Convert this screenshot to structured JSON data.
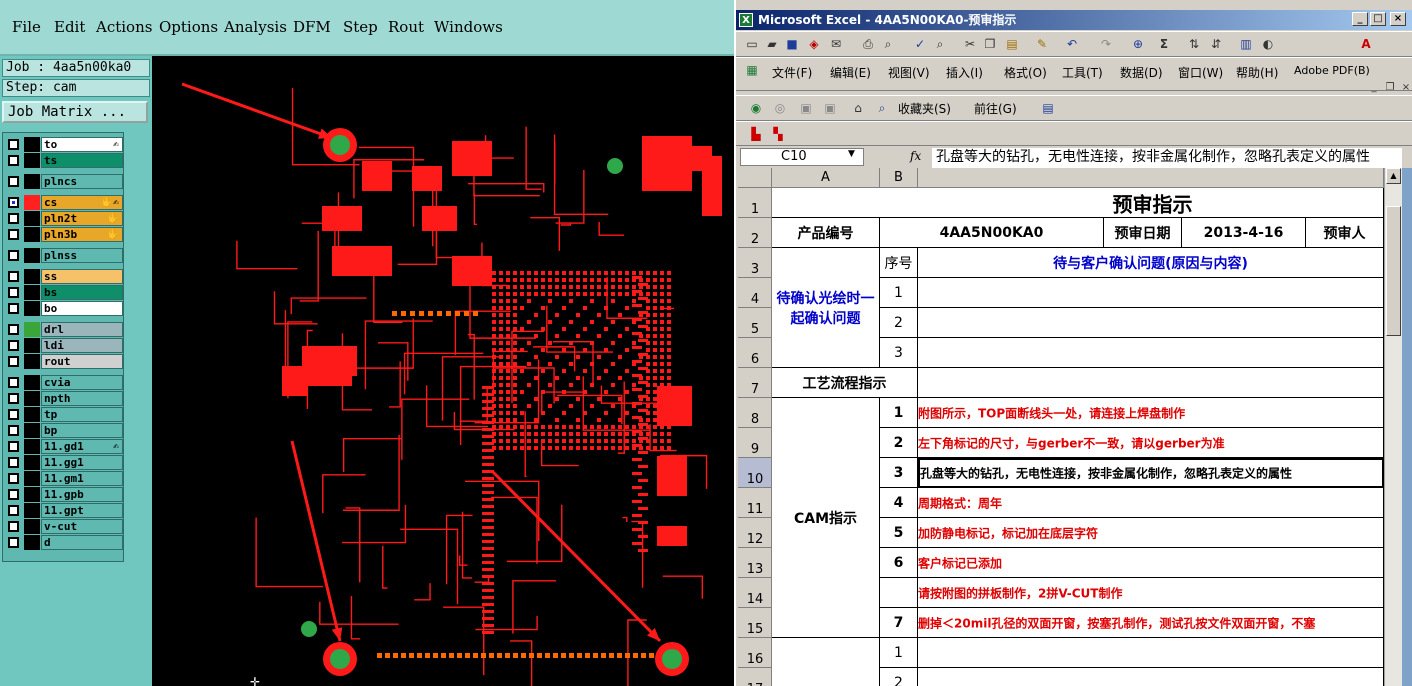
{
  "cam": {
    "menu": [
      "File",
      "Edit",
      "Actions",
      "Options",
      "Analysis",
      "DFM",
      "Step",
      "Rout",
      "Windows"
    ],
    "job_label": "Job : 4aa5n00ka0",
    "step_label": "Step: cam",
    "job_matrix_label": "Job Matrix ...",
    "layers": [
      {
        "name": "to",
        "color": "#ffffff",
        "swatch": "#000000",
        "flag": "✍",
        "checked": false
      },
      {
        "name": "ts",
        "color": "#0e8f6a",
        "swatch": "#000000",
        "flag": "",
        "checked": false
      },
      {
        "name": "plncs",
        "color": "#5fb9b1",
        "swatch": "#000000",
        "flag": "",
        "checked": false
      },
      {
        "name": "cs",
        "color": "#e8a728",
        "swatch": "#ff2020",
        "flag": "✋✍",
        "checked": true
      },
      {
        "name": "pln2t",
        "color": "#e8a728",
        "swatch": "#000000",
        "flag": "✋",
        "checked": false
      },
      {
        "name": "pln3b",
        "color": "#e8a728",
        "swatch": "#000000",
        "flag": "✋",
        "checked": false
      },
      {
        "name": "plnss",
        "color": "#5fb9b1",
        "swatch": "#000000",
        "flag": "",
        "checked": false
      },
      {
        "name": "ss",
        "color": "#f5c26a",
        "swatch": "#000000",
        "flag": "",
        "checked": false
      },
      {
        "name": "bs",
        "color": "#0e8f6a",
        "swatch": "#000000",
        "flag": "",
        "checked": false
      },
      {
        "name": "bo",
        "color": "#ffffff",
        "swatch": "#000000",
        "flag": "",
        "checked": false
      },
      {
        "name": "drl",
        "color": "#9bb5bd",
        "swatch": "#3aa63a",
        "flag": "",
        "checked": false
      },
      {
        "name": "ldi",
        "color": "#9bb5bd",
        "swatch": "#000000",
        "flag": "",
        "checked": false
      },
      {
        "name": "rout",
        "color": "#d0d0d0",
        "swatch": "#000000",
        "flag": "",
        "checked": false
      },
      {
        "name": "cvia",
        "color": "#5fb9b1",
        "swatch": "#000000",
        "flag": "",
        "checked": false
      },
      {
        "name": "npth",
        "color": "#5fb9b1",
        "swatch": "#000000",
        "flag": "",
        "checked": false
      },
      {
        "name": "tp",
        "color": "#5fb9b1",
        "swatch": "#000000",
        "flag": "",
        "checked": false
      },
      {
        "name": "bp",
        "color": "#5fb9b1",
        "swatch": "#000000",
        "flag": "",
        "checked": false
      },
      {
        "name": "11.gd1",
        "color": "#5fb9b1",
        "swatch": "#000000",
        "flag": "✍",
        "checked": false
      },
      {
        "name": "11.gg1",
        "color": "#5fb9b1",
        "swatch": "#000000",
        "flag": "",
        "checked": false
      },
      {
        "name": "11.gm1",
        "color": "#5fb9b1",
        "swatch": "#000000",
        "flag": "",
        "checked": false
      },
      {
        "name": "11.gpb",
        "color": "#5fb9b1",
        "swatch": "#000000",
        "flag": "",
        "checked": false
      },
      {
        "name": "11.gpt",
        "color": "#5fb9b1",
        "swatch": "#000000",
        "flag": "",
        "checked": false
      },
      {
        "name": "v-cut",
        "color": "#5fb9b1",
        "swatch": "#000000",
        "flag": "",
        "checked": false
      },
      {
        "name": "d",
        "color": "#5fb9b1",
        "swatch": "#000000",
        "flag": "",
        "checked": false
      }
    ],
    "colors": {
      "copper": "#ff1a1a",
      "drill": "#2fa84a",
      "pad": "#ff6a00"
    }
  },
  "excel": {
    "title": "Microsoft Excel - 4AA5N00KA0-预审指示",
    "menu": [
      "文件(F)",
      "编辑(E)",
      "视图(V)",
      "插入(I)",
      "格式(O)",
      "工具(T)",
      "数据(D)",
      "窗口(W)",
      "帮助(H)",
      "Adobe PDF(B)"
    ],
    "web_favorites": "收藏夹(S)",
    "web_goto": "前往(G)",
    "namebox": "C10",
    "fx": "fx",
    "formula": "孔盘等大的钻孔，无电性连接，按非金属化制作，忽略孔表定义的属性",
    "columns": [
      "A",
      "B"
    ],
    "rows": [
      "1",
      "2",
      "3",
      "4",
      "5",
      "6",
      "7",
      "8",
      "9",
      "10",
      "11",
      "12",
      "13",
      "14",
      "15",
      "16",
      "17"
    ],
    "sheet": {
      "title": "预审指示",
      "product_label": "产品编号",
      "product_value": "4AA5N00KA0",
      "date_label": "预审日期",
      "date_value": "2013-4-16",
      "reviewer_label": "预审人",
      "seq_label": "序号",
      "confirm_header": "待与客户确认问题(原因与内容)",
      "pending_label": "待确认光绘时一起确认问题",
      "pending_seq": [
        "1",
        "2",
        "3"
      ],
      "process_label": "工艺流程指示",
      "cam_label": "CAM指示",
      "cam_items": [
        {
          "seq": "1",
          "text": "附图所示，TOP面断线头一处，请连接上焊盘制作"
        },
        {
          "seq": "2",
          "text": "左下角标记的尺寸，与gerber不一致，请以gerber为准"
        },
        {
          "seq": "3",
          "text": "孔盘等大的钻孔，无电性连接，按非金属化制作，忽略孔表定义的属性"
        },
        {
          "seq": "4",
          "text": "周期格式：周年"
        },
        {
          "seq": "5",
          "text": "加防静电标记，标记加在底层字符"
        },
        {
          "seq": "6",
          "text": "客户标记已添加"
        },
        {
          "seq": "",
          "text": "请按附图的拼板制作，2拼V-CUT制作"
        },
        {
          "seq": "7",
          "text": "删掉＜20mil孔径的双面开窗，按塞孔制作，测试孔按文件双面开窗，不塞"
        }
      ],
      "next_seq": [
        "1",
        "2"
      ]
    }
  }
}
